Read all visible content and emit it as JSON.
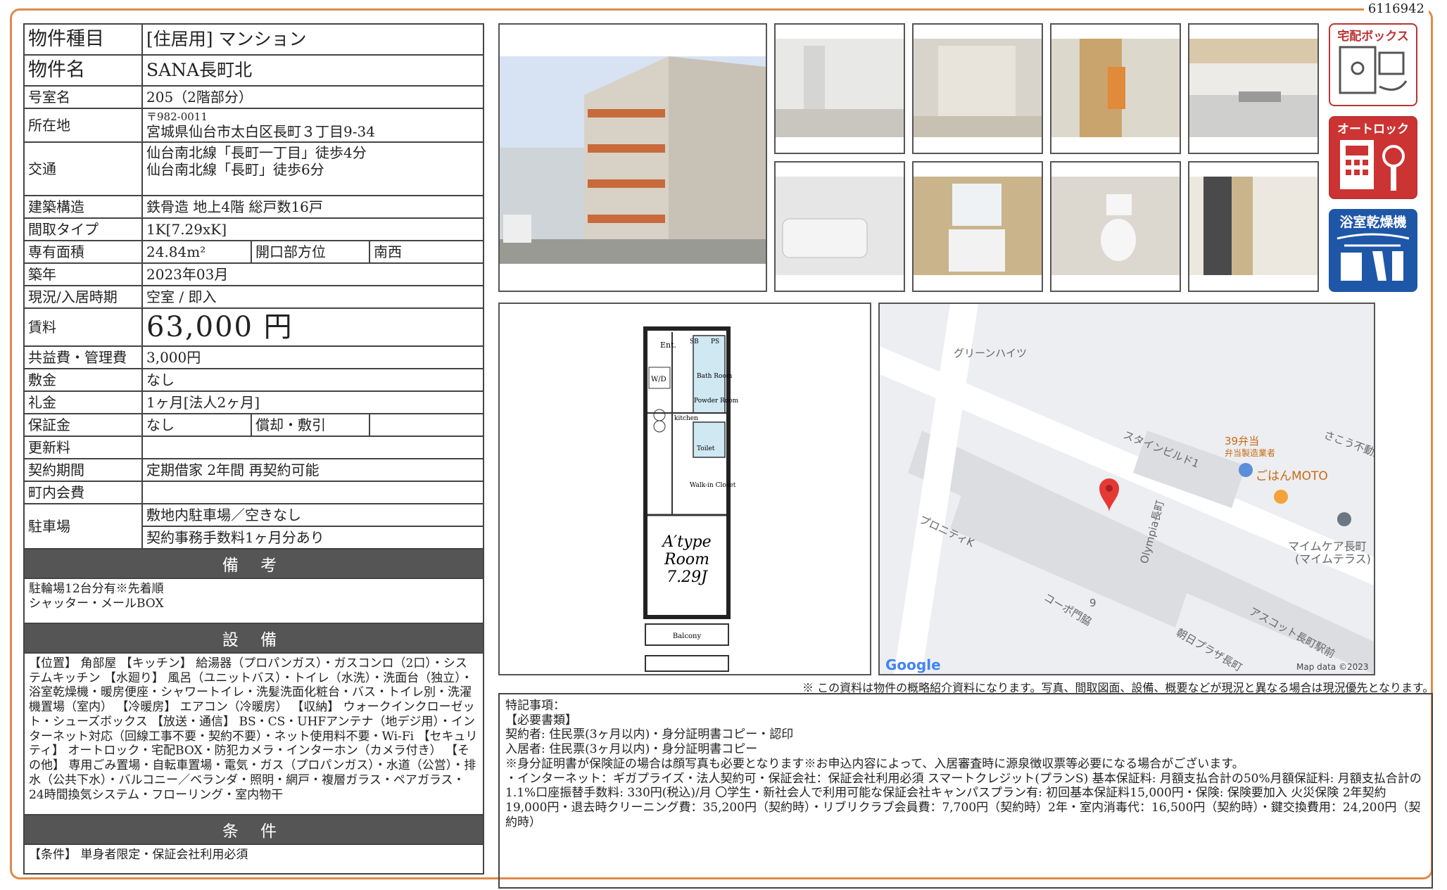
{
  "doc_id": "6116942",
  "info": {
    "type_label": "物件種目",
    "type_value": "[住居用]  マンション",
    "name_label": "物件名",
    "name_value": "SANA長町北",
    "room_label": "号室名",
    "room_value": "205（2階部分）",
    "addr_label": "所在地",
    "addr_zip": "〒982-0011",
    "addr_value": "宮城県仙台市太白区長町３丁目9-34",
    "access_label": "交通",
    "access_1": "仙台南北線「長町一丁目」徒歩4分",
    "access_2": "仙台南北線「長町」徒歩6分",
    "structure_label": "建築構造",
    "structure_value": "鉄骨造 地上4階 総戸数16戸",
    "layout_label": "間取タイプ",
    "layout_value": "1K[7.29xK]",
    "area_label": "専有面積",
    "area_value": "24.84m²",
    "direction_label": "開口部方位",
    "direction_value": "南西",
    "built_label": "築年",
    "built_value": "2023年03月",
    "status_label": "現況/入居時期",
    "status_value": "空室 / 即入",
    "rent_label": "賃料",
    "rent_value": "63,000 円",
    "fee_label": "共益費・管理費",
    "fee_value": "3,000円",
    "deposit_label": "敷金",
    "deposit_value": "なし",
    "key_label": "礼金",
    "key_value": "1ヶ月[法人2ヶ月]",
    "guarantee_label": "保証金",
    "guarantee_value": "なし",
    "amort_label": "償却・敷引",
    "amort_value": "",
    "renewal_label": "更新料",
    "renewal_value": "",
    "contract_label": "契約期間",
    "contract_value": "定期借家 2年間 再契約可能",
    "town_label": "町内会費",
    "town_value": "",
    "parking_label": "駐車場",
    "parking_1": "敷地内駐車場／空きなし",
    "parking_2": "契約事務手数料1ヶ月分あり"
  },
  "remarks": {
    "title": "備 考",
    "lines": [
      "駐輪場12台分有※先着順",
      "シャッター・メールBOX"
    ]
  },
  "equipment": {
    "title": "設 備",
    "text": "【位置】 角部屋 【キッチン】 給湯器（プロパンガス）・ガスコンロ（2口）・システムキッチン 【水廻り】 風呂（ユニットバス）・トイレ（水洗）・洗面台（独立）・浴室乾燥機・暖房便座・シャワートイレ・洗髪洗面化粧台・バス・トイレ別・洗濯機置場（室内） 【冷暖房】 エアコン（冷暖房） 【収納】 ウォークインクローゼット・シューズボックス 【放送・通信】 BS・CS・UHFアンテナ（地デジ用）・インターネット対応（回線工事不要・契約不要）・ネット使用料不要・Wi-Fi 【セキュリティ】 オートロック・宅配BOX・防犯カメラ・インターホン（カメラ付き） 【その他】 専用ごみ置場・自転車置場・電気・ガス（プロパンガス）・水道（公営）・排水（公共下水）・バルコニー／ベランダ・照明・網戸・複層ガラス・ペアガラス・24時間換気システム・フローリング・室内物干"
  },
  "conditions": {
    "title": "条 件",
    "text": "【条件】 単身者限定・保証会社利用必須"
  },
  "icons": {
    "delivery": "宅配ボックス",
    "autolock": "オートロック",
    "bathdryer": "浴室乾燥機"
  },
  "floorplan": {
    "type_line1": "A′type",
    "type_line2": "Room",
    "type_line3": "7.29J",
    "ent": "Ent.",
    "sb": "SB",
    "ps": "PS",
    "wd": "W/D",
    "bath": "Bath Room",
    "powder": "Powder Room",
    "kitchen": "kitchen",
    "toilet": "Toilet",
    "walkin": "Walk-in Closet",
    "balcony": "Balcony"
  },
  "map": {
    "labels": [
      "グリーンハイツ",
      "スタインビルド1",
      "39弁当",
      "弁当製造業者",
      "ごはんMOTO",
      "さこう不動産",
      "プロニティK",
      "Olympia長町",
      "マイムケア長町",
      "(マイムテラス)",
      "9",
      "コーポ門脇",
      "アスコット長町駅前",
      "朝日プラザ長町"
    ],
    "google": "Google",
    "copyright": "Map data ©2023"
  },
  "note": "※ この資料は物件の概略紹介資料になります。写真、間取図面、設備、概要などが現況と異なる場合は現況優先となります。",
  "special": {
    "lines": [
      "特記事項：",
      "【必要書類】",
      "契約者: 住民票(3ヶ月以内)・身分証明書コピー・認印",
      "入居者: 住民票(3ヶ月以内)・身分証明書コピー",
      "※身分証明書が保険証の場合は顔写真も必要となります※お申込内容によって、入居審査時に源泉徴収票等必要になる場合がございます。",
      "・インターネット：ギガプライズ・法人契約可・保証会社：保証会社利用必須 スマートクレジット(プランS) 基本保証料: 月額支払合計の50%月額保証料: 月額支払合計の1.1%口座振替手数料: 330円(税込)/月 〇学生・新社会人で利用可能な保証会社キャンパスプラン有: 初回基本保証料15,000円・保険: 保険要加入 火災保険 2年契約 19,000円・退去時クリーニング費：35,200円（契約時）・リブリクラブ会員費：7,700円（契約時）2年・室内消毒代：16,500円（契約時）・鍵交換費用：24,200円（契約時）"
    ]
  }
}
